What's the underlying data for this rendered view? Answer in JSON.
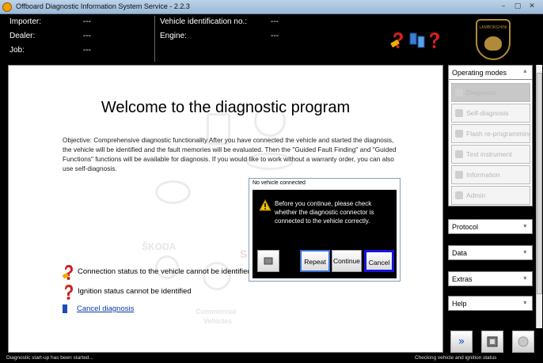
{
  "window": {
    "title": "Offboard Diagnostic Information System Service - 2.2.3",
    "controls": [
      "–",
      "▢",
      "✕"
    ]
  },
  "header": {
    "importer_label": "Importer:",
    "importer_value": "---",
    "dealer_label": "Dealer:",
    "dealer_value": "---",
    "job_label": "Job:",
    "job_value": "---",
    "vin_label": "Vehicle identification no.:",
    "vin_value": "---",
    "engine_label": "Engine:",
    "engine_value": "---",
    "logo_text": "LAMBORGHINI"
  },
  "main": {
    "welcome_title": "Welcome to the diagnostic program",
    "objective_text": "Objective: Comprehensive diagnostic functionality After you have connected the vehicle and started the diagnosis, the vehicle will be identified and the fault memories will be evaluated. Then the \"Guided Fault Finding\" and \"Guided Functions\" functions will be available for diagnosis. If you would like to work without a warranty order, you can also use self-diagnosis.",
    "watermarks": [
      "ŠKODA",
      "Commercial",
      "Vehicles",
      "S"
    ],
    "connection_status": "Connection status to the vehicle cannot be identified",
    "ignition_status": "Ignition status cannot be identified",
    "cancel_diagnosis": "Cancel diagnosis"
  },
  "dialog": {
    "title": "No vehicle connected",
    "message": "Before you continue, please check whether the diagnostic connector is connected to the vehicle correctly.",
    "repeat_label": "Repeat",
    "continue_label": "Continue",
    "cancel_label": "Cancel"
  },
  "rightpanel": {
    "operating_modes": "Operating modes",
    "items": [
      {
        "label": "Diagnosis",
        "selected": true
      },
      {
        "label": "Self-diagnosis",
        "selected": false
      },
      {
        "label": "Flash re-programming",
        "selected": false
      },
      {
        "label": "Test instrument",
        "selected": false
      },
      {
        "label": "Information",
        "selected": false
      },
      {
        "label": "Admin",
        "selected": false
      }
    ],
    "protocol": "Protocol",
    "data": "Data",
    "extras": "Extras",
    "help": "Help",
    "expand_chevron": "«",
    "collapse_chevron": "»"
  },
  "toolbar": {
    "forward_glyph": "»"
  },
  "statusbar": {
    "left_text": "Diagnostic start-up has been started...",
    "right_text": "Checking vehicle and ignition status"
  },
  "colors": {
    "accent_blue": "#1414e0",
    "question_red": "#d02020",
    "logo_gold": "#b08a3a"
  }
}
